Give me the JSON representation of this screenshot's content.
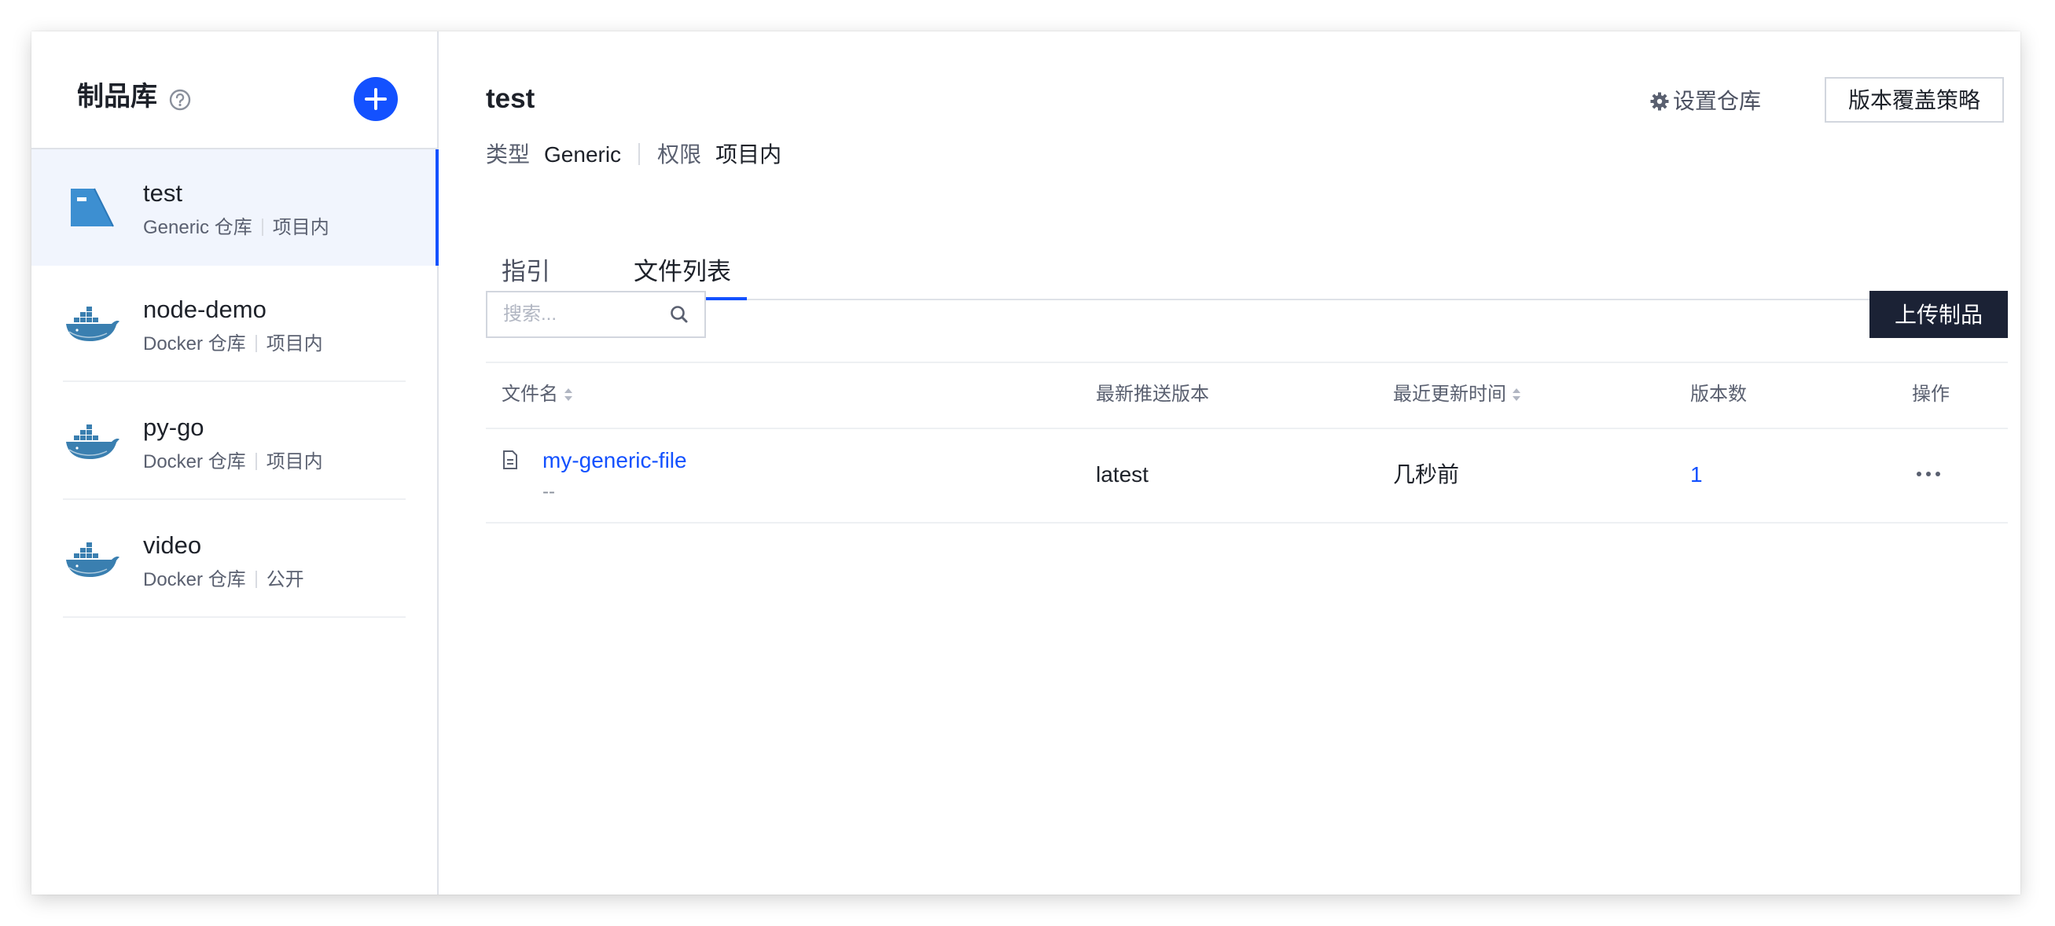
{
  "sidebar": {
    "title": "制品库",
    "help_icon": "question-circle-icon",
    "add_icon": "plus-icon",
    "repos": [
      {
        "name": "test",
        "type": "Generic 仓库",
        "scope": "项目内",
        "icon": "generic-repo-icon",
        "active": true
      },
      {
        "name": "node-demo",
        "type": "Docker 仓库",
        "scope": "项目内",
        "icon": "docker-icon"
      },
      {
        "name": "py-go",
        "type": "Docker 仓库",
        "scope": "项目内",
        "icon": "docker-icon"
      },
      {
        "name": "video",
        "type": "Docker 仓库",
        "scope": "公开",
        "icon": "docker-icon"
      }
    ]
  },
  "header": {
    "title": "test",
    "type_label": "类型",
    "type_value": "Generic",
    "perm_label": "权限",
    "perm_value": "项目内",
    "settings_label": "设置仓库",
    "policy_label": "版本覆盖策略"
  },
  "tabs": [
    {
      "label": "指引"
    },
    {
      "label": "文件列表",
      "active": true
    }
  ],
  "toolbar": {
    "search_placeholder": "搜索...",
    "upload_label": "上传制品"
  },
  "table": {
    "columns": [
      "文件名",
      "最新推送版本",
      "最近更新时间",
      "版本数",
      "操作"
    ],
    "rows": [
      {
        "name": "my-generic-file",
        "desc": "--",
        "version": "latest",
        "updated": "几秒前",
        "count": "1"
      }
    ]
  },
  "colors": {
    "accent": "#1351ff",
    "dark_button": "#1b2235",
    "active_row_bg": "#f1f5fd"
  }
}
